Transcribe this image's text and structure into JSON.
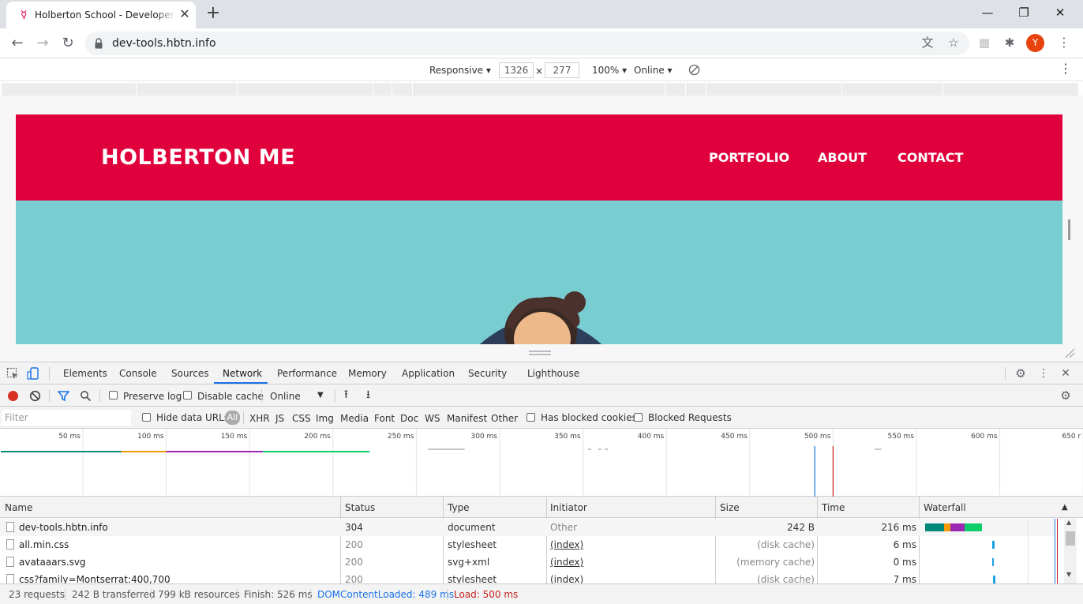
{
  "browser": {
    "tab_title": "Holberton School - Developer to",
    "url": "dev-tools.hbtn.info",
    "profile_initial": "Y"
  },
  "device_toolbar": {
    "mode": "Responsive ▾",
    "width": "1326",
    "height": "277",
    "times": "×",
    "zoom": "100% ▾",
    "throttle": "Online ▾"
  },
  "site": {
    "title": "HOLBERTON ME",
    "nav": [
      "PORTFOLIO",
      "ABOUT",
      "CONTACT"
    ],
    "colors": {
      "header": "#e0003c",
      "hero": "#78cdd1"
    }
  },
  "devtools": {
    "tabs": [
      "Elements",
      "Console",
      "Sources",
      "Network",
      "Performance",
      "Memory",
      "Application",
      "Security",
      "Lighthouse"
    ],
    "active_tab": "Network",
    "toolbar": {
      "preserve_log": "Preserve log",
      "disable_cache": "Disable cache",
      "throttle": "Online"
    },
    "filter": {
      "placeholder": "Filter",
      "hide_data_urls": "Hide data URLs",
      "all": "All",
      "types": [
        "XHR",
        "JS",
        "CSS",
        "Img",
        "Media",
        "Font",
        "Doc",
        "WS",
        "Manifest",
        "Other"
      ],
      "has_blocked_cookies": "Has blocked cookies",
      "blocked_requests": "Blocked Requests"
    },
    "overview": {
      "ticks": [
        "50 ms",
        "100 ms",
        "150 ms",
        "200 ms",
        "250 ms",
        "300 ms",
        "350 ms",
        "400 ms",
        "450 ms",
        "500 ms",
        "550 ms",
        "600 ms",
        "650 r"
      ],
      "dom_content_loaded_ms": 489,
      "load_ms": 500
    },
    "table": {
      "columns": [
        "Name",
        "Status",
        "Type",
        "Initiator",
        "Size",
        "Time",
        "Waterfall"
      ],
      "rows": [
        {
          "name": "dev-tools.hbtn.info",
          "status": "304",
          "type": "document",
          "initiator": "Other",
          "size": "242 B",
          "time": "216 ms"
        },
        {
          "name": "all.min.css",
          "status": "200",
          "type": "stylesheet",
          "initiator": "(index)",
          "size": "(disk cache)",
          "time": "6 ms"
        },
        {
          "name": "avataaars.svg",
          "status": "200",
          "type": "svg+xml",
          "initiator": "(index)",
          "size": "(memory cache)",
          "time": "0 ms"
        },
        {
          "name": "css?family=Montserrat:400,700",
          "status": "200",
          "type": "stylesheet",
          "initiator": "(index)",
          "size": "(disk cache)",
          "time": "7 ms"
        }
      ]
    },
    "status": {
      "requests": "23 requests",
      "transferred": "242 B transferred",
      "resources": "799 kB resources",
      "finish": "Finish: 526 ms",
      "dcl": "DOMContentLoaded: 489 ms",
      "load": "Load: 500 ms"
    },
    "colors": {
      "dcl": "#1a73e8",
      "load": "#c5221f",
      "accent": "#1a73e8"
    }
  }
}
